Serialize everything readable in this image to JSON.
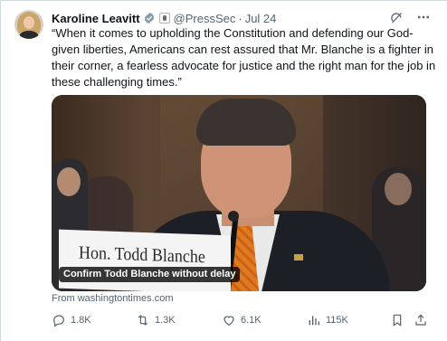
{
  "author": {
    "name": "Karoline Leavitt",
    "handle": "@PressSec",
    "separator": "·",
    "date": "Jul 24"
  },
  "icons": {
    "verified": "verified-badge-icon",
    "government": "government-badge-icon",
    "grok": "grok-icon",
    "more": "more-icon",
    "reply": "reply-icon",
    "retweet": "retweet-icon",
    "like": "like-icon",
    "views": "views-icon",
    "bookmark": "bookmark-icon",
    "share": "share-icon"
  },
  "tweet": {
    "text": "“When it comes to upholding the Constitution and defending our God-\ngiven liberties, Americans can rest assured that Mr. Blanche is a fighter in\ntheir corner, a fearless advocate for justice and the right man for the job in\nthese challenging times.”"
  },
  "media": {
    "nameplate_text": "Hon. Todd Blanche",
    "caption": "Confirm Todd Blanche without delay"
  },
  "source": {
    "label": "From washingtontimes.com"
  },
  "metrics": {
    "replies": "1.8K",
    "retweets": "1.3K",
    "likes": "6.1K",
    "views": "115K"
  },
  "colors": {
    "text_primary": "#0f1419",
    "text_secondary": "#536471",
    "verified_blue": "#1d9bf0",
    "border": "#cfd9de"
  }
}
